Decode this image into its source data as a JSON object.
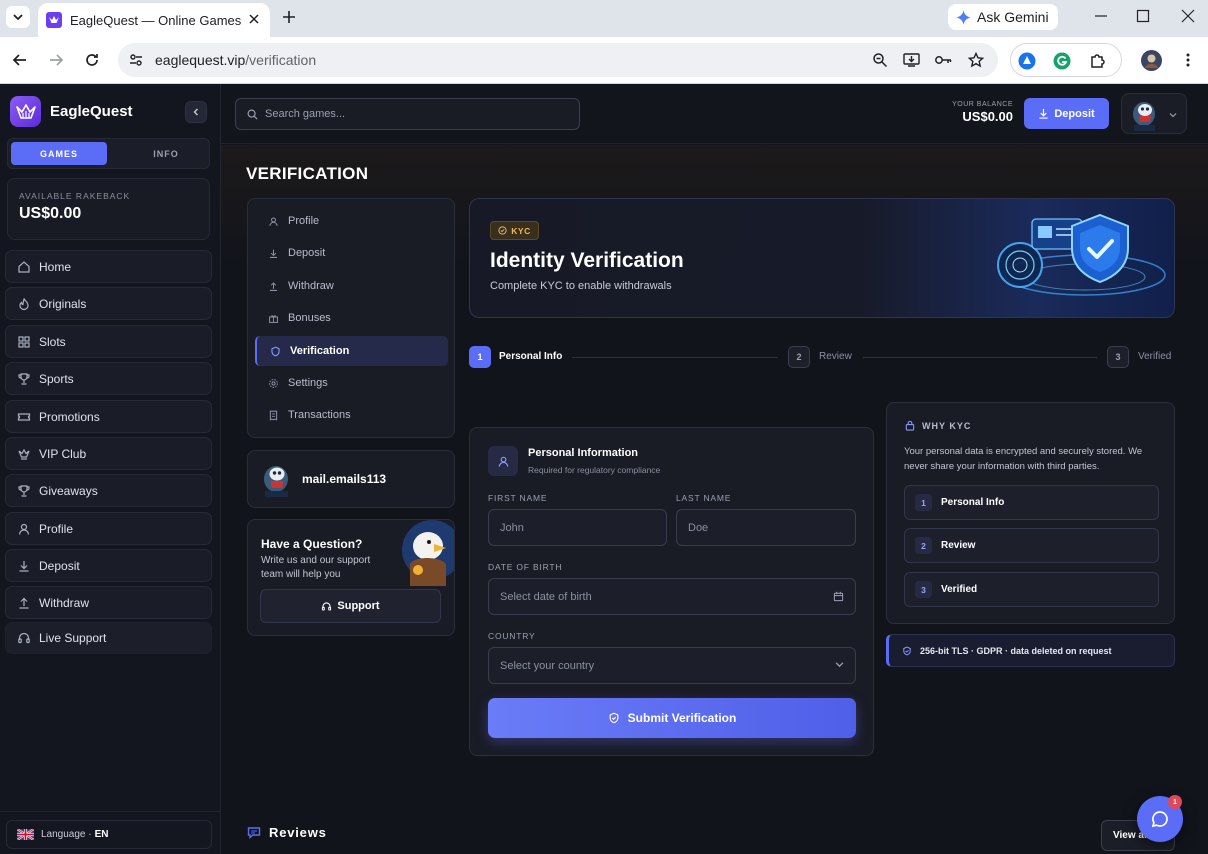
{
  "browser": {
    "tab_title": "EagleQuest — Online Games &",
    "gemini_label": "Ask Gemini",
    "url_host": "eaglequest.vip",
    "url_path": "/verification"
  },
  "sidebar": {
    "brand": "EagleQuest",
    "tabs": [
      {
        "label": "GAMES"
      },
      {
        "label": "INFO"
      }
    ],
    "rakeback_label": "AVAILABLE RAKEBACK",
    "rakeback_value": "US$0.00",
    "items": [
      {
        "label": "Home",
        "icon": "home-icon"
      },
      {
        "label": "Originals",
        "icon": "flame-icon"
      },
      {
        "label": "Slots",
        "icon": "grid-icon"
      },
      {
        "label": "Sports",
        "icon": "trophy-icon"
      },
      {
        "label": "Promotions",
        "icon": "ticket-icon"
      },
      {
        "label": "VIP Club",
        "icon": "crown-icon"
      },
      {
        "label": "Giveaways",
        "icon": "trophy-icon"
      },
      {
        "label": "Profile",
        "icon": "user-icon"
      },
      {
        "label": "Deposit",
        "icon": "download-icon"
      },
      {
        "label": "Withdraw",
        "icon": "upload-icon"
      },
      {
        "label": "Live Support",
        "icon": "headset-icon"
      }
    ],
    "language_label": "Language ·",
    "language_code": "EN"
  },
  "topbar": {
    "search_placeholder": "Search games...",
    "balance_label": "YOUR BALANCE",
    "balance_value": "US$0.00",
    "deposit_label": "Deposit"
  },
  "page": {
    "title": "VERIFICATION",
    "submenu": [
      {
        "label": "Profile",
        "icon": "user-icon"
      },
      {
        "label": "Deposit",
        "icon": "download-icon"
      },
      {
        "label": "Withdraw",
        "icon": "upload-icon"
      },
      {
        "label": "Bonuses",
        "icon": "gift-icon"
      },
      {
        "label": "Verification",
        "icon": "shield-icon",
        "active": true
      },
      {
        "label": "Settings",
        "icon": "gear-icon"
      },
      {
        "label": "Transactions",
        "icon": "receipt-icon"
      }
    ],
    "username": "mail.emails113",
    "question": {
      "title": "Have a Question?",
      "body": "Write us and our support team will help you",
      "button": "Support"
    },
    "banner": {
      "badge": "KYC",
      "title": "Identity Verification",
      "subtitle": "Complete KYC to enable withdrawals"
    },
    "steps": [
      {
        "num": "1",
        "label": "Personal Info",
        "active": true
      },
      {
        "num": "2",
        "label": "Review",
        "active": false
      },
      {
        "num": "3",
        "label": "Verified",
        "active": false
      }
    ],
    "form": {
      "title": "Personal Information",
      "subtitle": "Required for regulatory compliance",
      "first_name_label": "FIRST NAME",
      "first_name_placeholder": "John",
      "last_name_label": "LAST NAME",
      "last_name_placeholder": "Doe",
      "dob_label": "DATE OF BIRTH",
      "dob_placeholder": "Select date of birth",
      "country_label": "COUNTRY",
      "country_placeholder": "Select your country",
      "submit_label": "Submit Verification"
    },
    "why": {
      "title": "WHY KYC",
      "body": "Your personal data is encrypted and securely stored. We never share your information with third parties.",
      "steps": [
        {
          "num": "1",
          "label": "Personal Info"
        },
        {
          "num": "2",
          "label": "Review"
        },
        {
          "num": "3",
          "label": "Verified"
        }
      ]
    },
    "security_note": "256-bit TLS · GDPR · data deleted on request",
    "reviews_title": "Reviews",
    "view_all_label": "View all",
    "chat_badge_count": "1"
  },
  "colors": {
    "accent": "#5b6cf6",
    "background": "#12141c",
    "kyc_badge": "#e9b95a",
    "chat_badge": "#e0485a"
  }
}
